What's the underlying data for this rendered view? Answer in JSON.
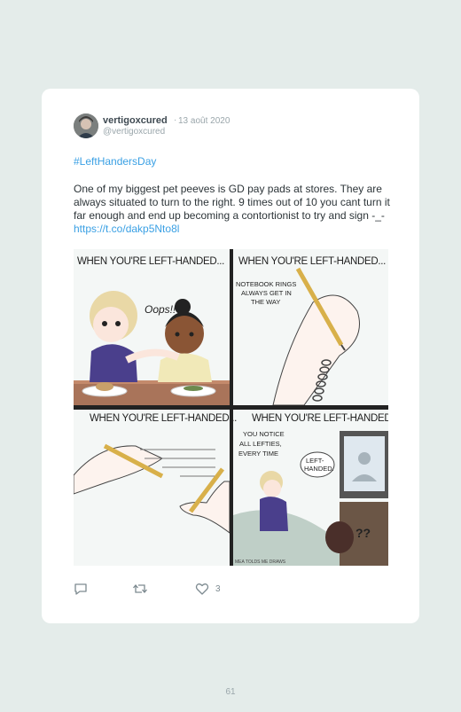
{
  "tweet": {
    "username": "vertigoxcured",
    "separator": "·",
    "date": "13 août 2020",
    "handle": "@vertigoxcured",
    "hashtag": "#LeftHandersDay",
    "text": "One of my biggest pet peeves is GD pay pads at stores. They are always situated to turn to the right. 9 times out of 10 you cant turn it far enough and end up becoming a contortionist to try and sign -_- ",
    "link": "https://t.co/dakp5Nto8l",
    "likes": "3"
  },
  "comic": {
    "panel_caption": "WHEN YOU'RE LEFT-HANDED...",
    "panel1_speech": "Oops!!",
    "panel2_note": [
      "NOTEBOOK RINGS",
      "ALWAYS GET IN",
      "THE WAY"
    ],
    "panel4_note": [
      "YOU NOTICE",
      "ALL LEFTIES,",
      "EVERY TIME"
    ],
    "panel4_bubble": [
      "LEFT-",
      "HANDED."
    ],
    "panel4_question": "??",
    "credit": "MEA TOLDS ME DRAWS"
  },
  "icons": {
    "reply": "reply-icon",
    "retweet": "retweet-icon",
    "like": "heart-icon"
  },
  "colors": {
    "link": "#3aa0e4",
    "background": "#e4ecea"
  },
  "page_number": "61"
}
